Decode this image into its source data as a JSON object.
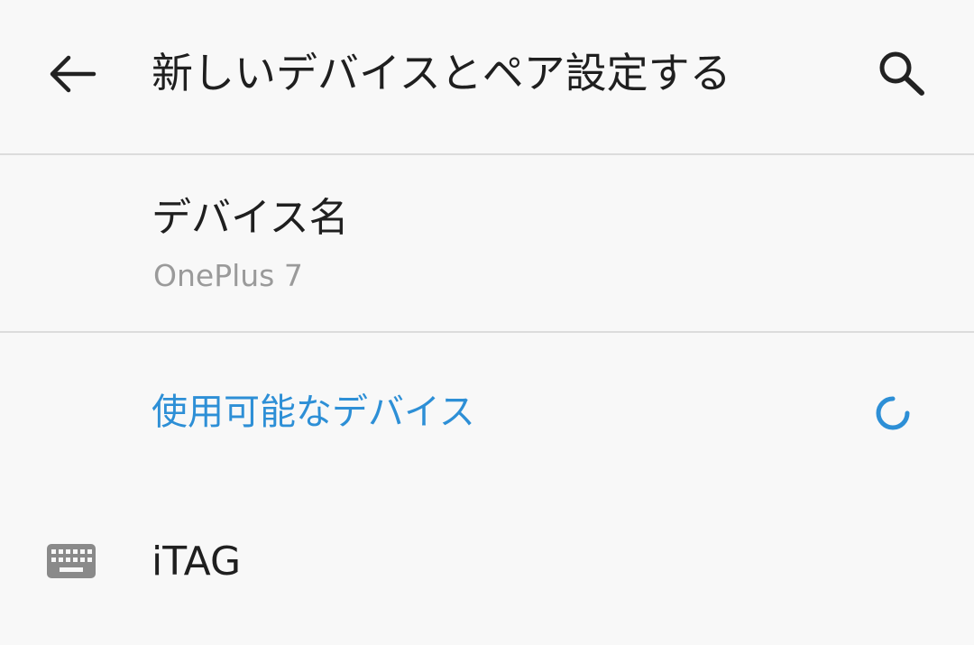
{
  "toolbar": {
    "back_icon": "arrow-back-icon",
    "title": "新しいデバイスとペア設定する",
    "search_icon": "search-icon"
  },
  "device_name": {
    "title": "デバイス名",
    "value": "OnePlus 7"
  },
  "available_devices": {
    "header": "使用可能なデバイス",
    "progress_icon": "loading-spinner-icon",
    "accent_color": "#2d8fd6",
    "items": [
      {
        "icon": "keyboard-icon",
        "label": "iTAG"
      }
    ]
  }
}
